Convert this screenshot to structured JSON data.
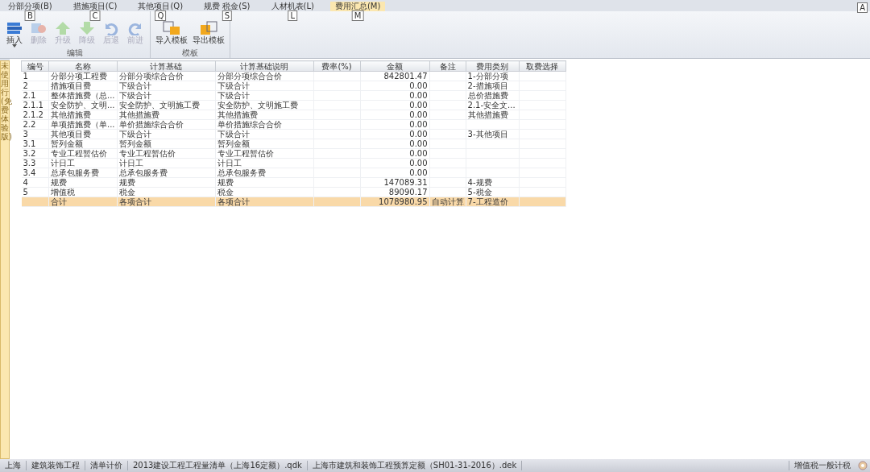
{
  "ribbon_tabs": [
    {
      "label": "分部分项(B)",
      "keytip": "B",
      "selected": false
    },
    {
      "label": "措施项目(C)",
      "keytip": "C",
      "selected": false
    },
    {
      "label": "其他项目(Q)",
      "keytip": "Q",
      "selected": false
    },
    {
      "label": "规费 税金(S)",
      "keytip": "S",
      "selected": false
    },
    {
      "label": "人材机表(L)",
      "keytip": "L",
      "selected": false
    },
    {
      "label": "费用汇总(M)",
      "keytip": "M",
      "selected": true
    }
  ],
  "help_keytip": "A",
  "ribbon_groups": [
    {
      "title": "编辑",
      "buttons": [
        {
          "label": "插入",
          "disabled": false,
          "dropdown": true
        },
        {
          "label": "删除",
          "disabled": true,
          "dropdown": false
        },
        {
          "label": "升级",
          "disabled": true,
          "dropdown": false
        },
        {
          "label": "降级",
          "disabled": true,
          "dropdown": false
        },
        {
          "label": "后退",
          "disabled": true,
          "dropdown": false
        },
        {
          "label": "前进",
          "disabled": true,
          "dropdown": false
        }
      ]
    },
    {
      "title": "模板",
      "buttons": [
        {
          "label": "导入模板",
          "disabled": false,
          "dropdown": false
        },
        {
          "label": "导出模板",
          "disabled": false,
          "dropdown": false
        }
      ]
    }
  ],
  "side_tab": "未使用行(免费体验版)",
  "table": {
    "columns": [
      "编号",
      "名称",
      "计算基础",
      "计算基础说明",
      "费率(%)",
      "金额",
      "备注",
      "费用类别",
      "取费选择"
    ],
    "rows": [
      {
        "kind": "item",
        "cells": [
          "1",
          "分部分项工程费",
          "分部分项综合合价",
          "分部分项综合合价",
          "",
          "842801.47",
          "",
          "1-分部分项",
          ""
        ]
      },
      {
        "kind": "item",
        "cells": [
          "2",
          "措施项目费",
          "下级合计",
          "下级合计",
          "",
          "0.00",
          "",
          "2-措施项目",
          ""
        ]
      },
      {
        "kind": "item",
        "cells": [
          "2.1",
          "整体措施费（总...",
          "下级合计",
          "下级合计",
          "",
          "0.00",
          "",
          "总价措施费",
          ""
        ]
      },
      {
        "kind": "item",
        "cells": [
          "2.1.1",
          "安全防护、文明...",
          "安全防护、文明施工费",
          "安全防护、文明施工费",
          "",
          "0.00",
          "",
          "2.1-安全文...",
          ""
        ]
      },
      {
        "kind": "item",
        "cells": [
          "2.1.2",
          "其他措施费",
          "其他措施费",
          "其他措施费",
          "",
          "0.00",
          "",
          "其他措施费",
          ""
        ]
      },
      {
        "kind": "item",
        "cells": [
          "2.2",
          "单项措施费（单...",
          "单价措施综合合价",
          "单价措施综合合价",
          "",
          "0.00",
          "",
          "",
          ""
        ]
      },
      {
        "kind": "item",
        "cells": [
          "3",
          "其他项目费",
          "下级合计",
          "下级合计",
          "",
          "0.00",
          "",
          "3-其他项目",
          ""
        ]
      },
      {
        "kind": "item",
        "cells": [
          "3.1",
          "暂列金额",
          "暂列金额",
          "暂列金额",
          "",
          "0.00",
          "",
          "",
          ""
        ]
      },
      {
        "kind": "item",
        "cells": [
          "3.2",
          "专业工程暂估价",
          "专业工程暂估价",
          "专业工程暂估价",
          "",
          "0.00",
          "",
          "",
          ""
        ]
      },
      {
        "kind": "item",
        "cells": [
          "3.3",
          "计日工",
          "计日工",
          "计日工",
          "",
          "0.00",
          "",
          "",
          ""
        ]
      },
      {
        "kind": "item",
        "cells": [
          "3.4",
          "总承包服务费",
          "总承包服务费",
          "总承包服务费",
          "",
          "0.00",
          "",
          "",
          ""
        ]
      },
      {
        "kind": "item",
        "cells": [
          "4",
          "规费",
          "规费",
          "规费",
          "",
          "147089.31",
          "",
          "4-规费",
          ""
        ]
      },
      {
        "kind": "item",
        "cells": [
          "5",
          "增值税",
          "税金",
          "税金",
          "",
          "89090.17",
          "",
          "5-税金",
          ""
        ]
      },
      {
        "kind": "total",
        "cells": [
          "",
          "合计",
          "各项合计",
          "各项合计",
          "",
          "1078980.95",
          "自动计算",
          "7-工程造价",
          ""
        ]
      }
    ]
  },
  "status_bar": {
    "items": [
      "上海",
      "建筑装饰工程",
      "清单计价",
      "2013建设工程工程量清单（上海16定额）.qdk",
      "上海市建筑和装饰工程预算定额（SH01-31-2016）.dek"
    ],
    "right": "增值税一般计税"
  }
}
